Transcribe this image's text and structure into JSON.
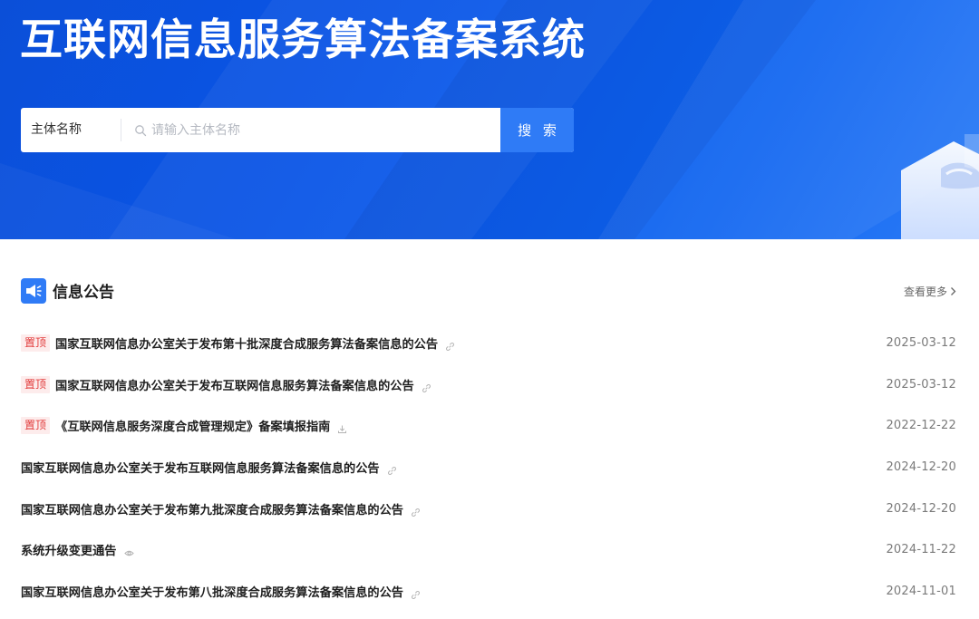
{
  "hero": {
    "title": "互联网信息服务算法备案系统"
  },
  "search": {
    "type_label": "主体名称",
    "placeholder": "请输入主体名称",
    "value": "",
    "button_label": "搜 索"
  },
  "notice": {
    "title": "信息公告",
    "more_label": "查看更多",
    "pin_label": "置顶",
    "items": [
      {
        "pinned": true,
        "title": "国家互联网信息办公室关于发布第十批深度合成服务算法备案信息的公告",
        "icon": "link-icon",
        "date": "2025-03-12"
      },
      {
        "pinned": true,
        "title": "国家互联网信息办公室关于发布互联网信息服务算法备案信息的公告",
        "icon": "link-icon",
        "date": "2025-03-12"
      },
      {
        "pinned": true,
        "title": "《互联网信息服务深度合成管理规定》备案填报指南",
        "icon": "download-icon",
        "date": "2022-12-22"
      },
      {
        "pinned": false,
        "title": "国家互联网信息办公室关于发布互联网信息服务算法备案信息的公告",
        "icon": "link-icon",
        "date": "2024-12-20"
      },
      {
        "pinned": false,
        "title": "国家互联网信息办公室关于发布第九批深度合成服务算法备案信息的公告",
        "icon": "link-icon",
        "date": "2024-12-20"
      },
      {
        "pinned": false,
        "title": "系统升级变更通告",
        "icon": "eye-icon",
        "date": "2024-11-22"
      },
      {
        "pinned": false,
        "title": "国家互联网信息办公室关于发布第八批深度合成服务算法备案信息的公告",
        "icon": "link-icon",
        "date": "2024-11-01"
      }
    ]
  },
  "colors": {
    "primary": "#2f7bf6",
    "hero_dark": "#0b4fd8",
    "pin_bg": "#fdecec",
    "pin_text": "#e23b3b",
    "date_text": "#7a7a7a"
  }
}
